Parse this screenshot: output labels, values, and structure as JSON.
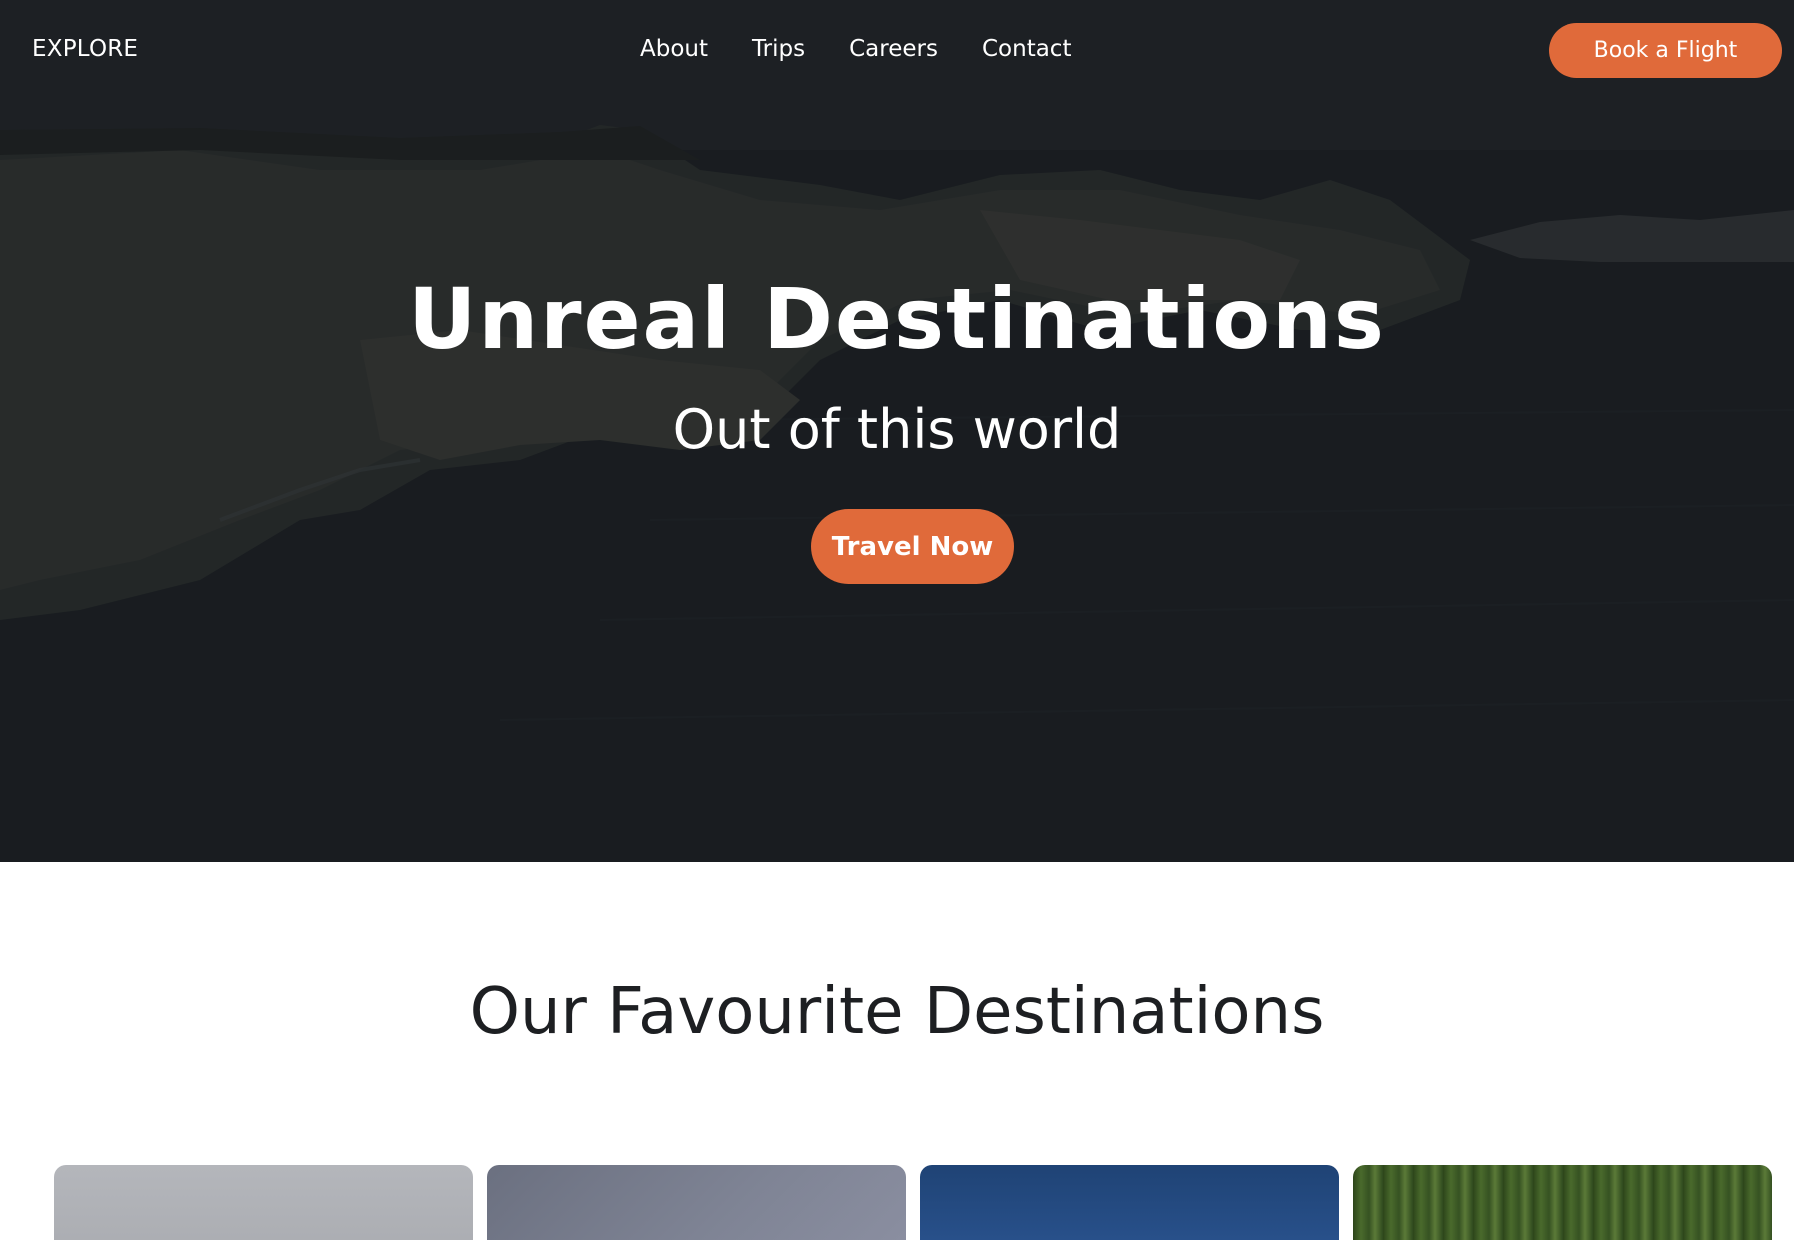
{
  "nav": {
    "logo": "EXPLORE",
    "links": [
      "About",
      "Trips",
      "Careers",
      "Contact"
    ],
    "cta": "Book a Flight"
  },
  "hero": {
    "title": "Unreal Destinations",
    "subtitle": "Out of this world",
    "cta": "Travel Now"
  },
  "section": {
    "title": "Our Favourite Destinations"
  },
  "colors": {
    "accent": "#e06a3a",
    "hero_overlay": "#1f2226",
    "text_dark": "#1d1f22",
    "card_backgrounds": [
      "#b0b2b7",
      "#767c8d",
      "#24487a",
      "#3d5b24"
    ]
  }
}
